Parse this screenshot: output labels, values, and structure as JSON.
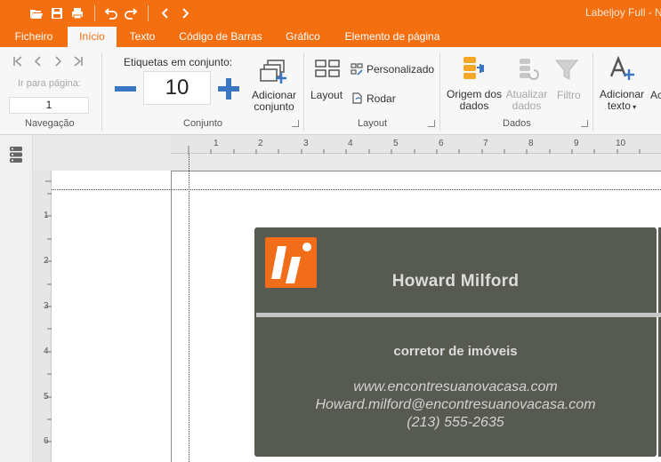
{
  "window": {
    "title": "Labeljoy Full - N"
  },
  "quick_access": {
    "icons": [
      "open-folder-icon",
      "save-icon",
      "print-icon",
      "undo-icon",
      "redo-icon",
      "back-icon",
      "forward-icon"
    ]
  },
  "tabs": [
    {
      "label": "Ficheiro",
      "active": false
    },
    {
      "label": "Início",
      "active": true
    },
    {
      "label": "Texto",
      "active": false
    },
    {
      "label": "Código de Barras",
      "active": false
    },
    {
      "label": "Gráfico",
      "active": false
    },
    {
      "label": "Elemento de página",
      "active": false
    }
  ],
  "ribbon": {
    "navigation": {
      "go_to_page_label": "Ir para página:",
      "page_value": "1",
      "group_label": "Navegação"
    },
    "conjunto": {
      "labels_in_set_label": "Etiquetas em conjunto:",
      "count_value": "10",
      "add_set_label_line1": "Adicionar",
      "add_set_label_line2": "conjunto",
      "group_label": "Conjunto"
    },
    "layout": {
      "layout_button": "Layout",
      "custom_button": "Personalizado",
      "rotate_button": "Rodar",
      "group_label": "Layout"
    },
    "dados": {
      "data_source_line1": "Origem dos",
      "data_source_line2": "dados",
      "refresh_line1": "Atualizar",
      "refresh_line2": "dados",
      "filter_label": "Filtro",
      "group_label": "Dados"
    },
    "text_group": {
      "add_text_line1": "Adicionar",
      "add_text_line2": "texto",
      "partial_label": "Ac"
    }
  },
  "rulers": {
    "top_numbers": [
      "1",
      "2",
      "3",
      "4",
      "5",
      "6",
      "7",
      "8",
      "9",
      "10"
    ],
    "left_numbers": [
      "1",
      "2",
      "3",
      "4",
      "5",
      "6"
    ]
  },
  "card": {
    "name": "Howard Milford",
    "role": "corretor de imóveis",
    "website": "www.encontresuanovacasa.com",
    "email": "Howard.milford@encontresuanovacasa.com",
    "phone": "(213) 555-2635",
    "colors": {
      "background": "#565a51",
      "accent": "#f26d1a",
      "text": "#dcdcdc"
    }
  },
  "colors": {
    "brand": "#f36f10",
    "ribbon_bg": "#f7f7f7",
    "accent_blue": "#3a76c4"
  }
}
